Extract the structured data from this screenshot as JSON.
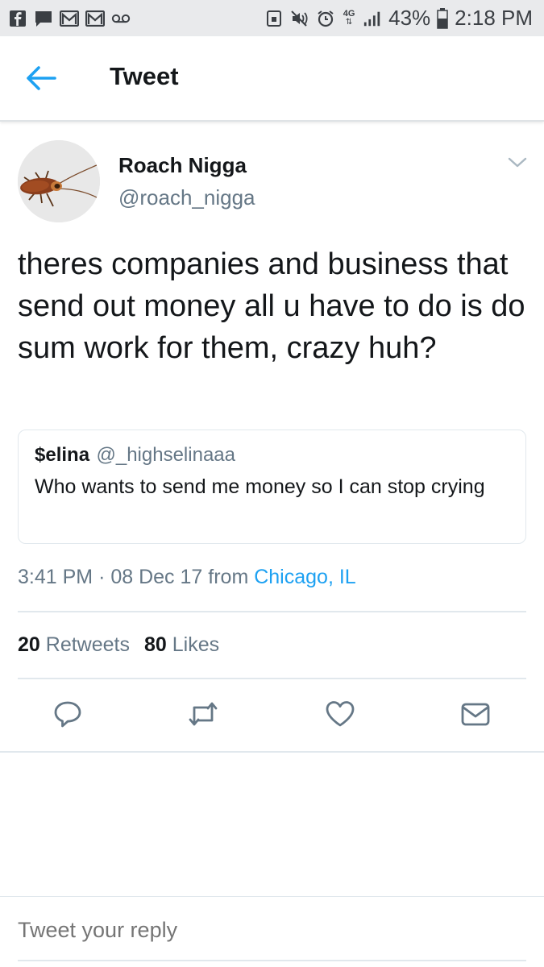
{
  "status_bar": {
    "battery": "43%",
    "time": "2:18 PM",
    "network": "4G",
    "left_icons": [
      "facebook-icon",
      "message-icon",
      "gmail-icon",
      "gmail-icon",
      "voicemail-icon"
    ],
    "right_icons": [
      "lock-icon",
      "mute-icon",
      "alarm-icon",
      "network-icon",
      "signal-icon",
      "battery-icon"
    ]
  },
  "header": {
    "title": "Tweet",
    "accent": "#1da1f2"
  },
  "tweet": {
    "display_name": "Roach Nigga",
    "handle": "@roach_nigga",
    "text": "theres companies and business that send out money all u have to do is do sum work for them, crazy huh?",
    "quote": {
      "name": "$elina",
      "handle": "@_highselinaaa",
      "text": "Who wants to send me money so I can stop crying"
    },
    "time": "3:41 PM",
    "date": "08 Dec 17",
    "from_label": "from",
    "location": "Chicago, IL",
    "retweets_count": "20",
    "retweets_label": "Retweets",
    "likes_count": "80",
    "likes_label": "Likes"
  },
  "reply": {
    "placeholder": "Tweet your reply"
  }
}
